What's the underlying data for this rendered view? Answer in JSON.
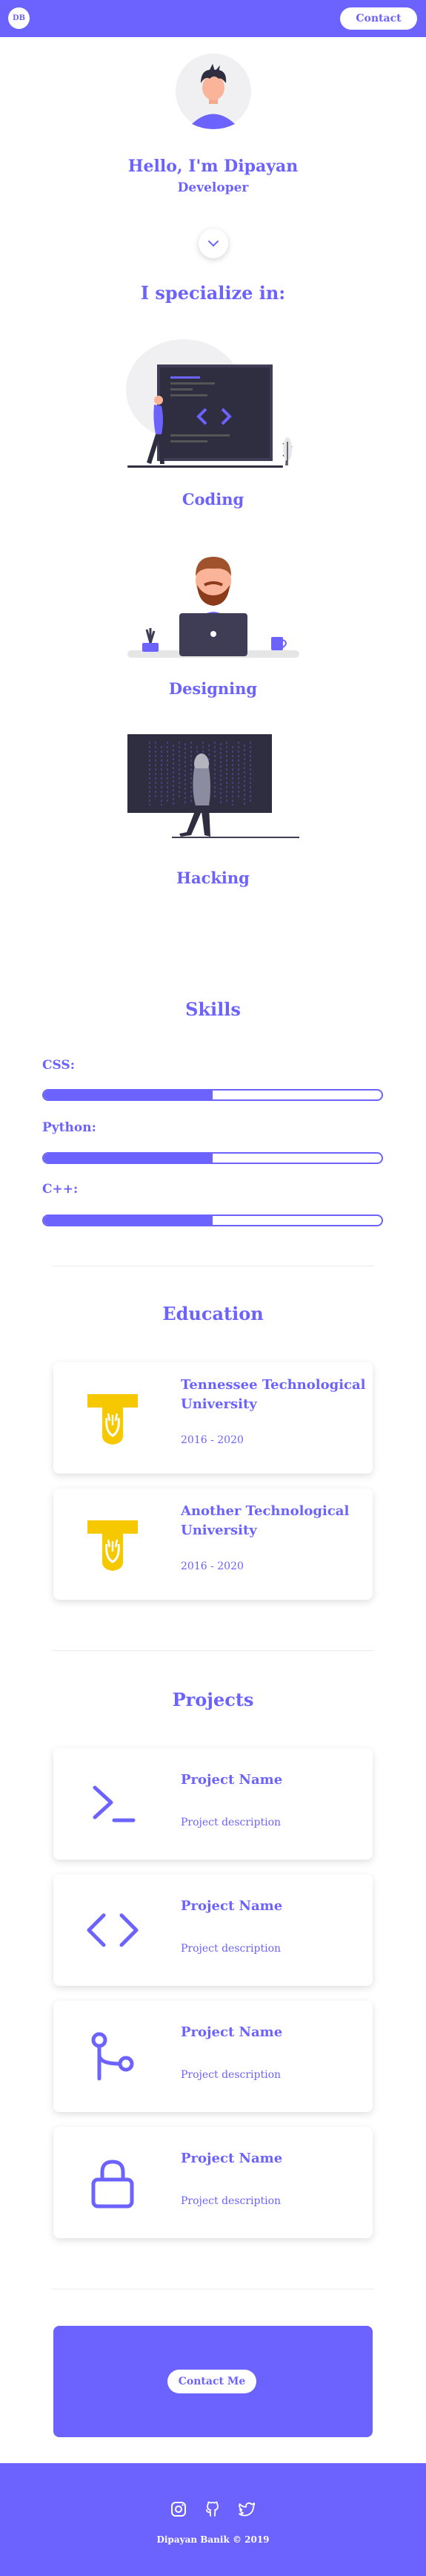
{
  "nav": {
    "logo_text": "DB",
    "contact_label": "Contact"
  },
  "hero": {
    "title": "Hello, I'm Dipayan",
    "subtitle": "Developer"
  },
  "specialize": {
    "title": "I specialize in:",
    "items": [
      {
        "label": "Coding"
      },
      {
        "label": "Designing"
      },
      {
        "label": "Hacking"
      }
    ]
  },
  "skills": {
    "title": "Skills",
    "items": [
      {
        "label": "CSS:",
        "level": 0.5
      },
      {
        "label": "Python:",
        "level": 0.5
      },
      {
        "label": "C++:",
        "level": 0.5
      }
    ]
  },
  "education": {
    "title": "Education",
    "items": [
      {
        "name": "Tennessee Technological University",
        "years": "2016 - 2020"
      },
      {
        "name": "Another Technological University",
        "years": "2016 - 2020"
      }
    ]
  },
  "projects": {
    "title": "Projects",
    "items": [
      {
        "name": "Project Name",
        "description": "Project description",
        "icon": "terminal-icon"
      },
      {
        "name": "Project Name",
        "description": "Project description",
        "icon": "code-icon"
      },
      {
        "name": "Project Name",
        "description": "Project description",
        "icon": "git-branch-icon"
      },
      {
        "name": "Project Name",
        "description": "Project description",
        "icon": "lock-icon"
      }
    ]
  },
  "cta": {
    "button_label": "Contact Me"
  },
  "footer": {
    "copyright": "Dipayan Banik © 2019",
    "social": [
      "instagram-icon",
      "github-icon",
      "twitter-icon"
    ]
  },
  "colors": {
    "accent": "#6c63ff",
    "gold": "#f5c800",
    "white": "#ffffff"
  }
}
